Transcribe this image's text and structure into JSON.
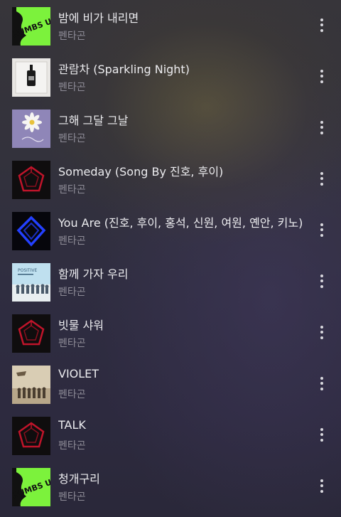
{
  "tracks": [
    {
      "title": "밤에 비가 내리면",
      "artist": "펜타곤",
      "cover": "thumbs-up-art"
    },
    {
      "title": "관람차 (Sparkling Night)",
      "artist": "펜타곤",
      "cover": "bottle-art"
    },
    {
      "title": "그해 그달 그날",
      "artist": "펜타곤",
      "cover": "daisy-art"
    },
    {
      "title": "Someday (Song By 진호, 후이)",
      "artist": "펜타곤",
      "cover": "red-pentagon-art"
    },
    {
      "title": "You Are (진호, 후이, 홍석, 신원, 여원, 옌안, 키노)",
      "artist": "펜타곤",
      "cover": "blue-pentagon-art"
    },
    {
      "title": "함께 가자 우리",
      "artist": "펜타곤",
      "cover": "positive-group-art"
    },
    {
      "title": "빗물 샤워",
      "artist": "펜타곤",
      "cover": "red-pentagon-art"
    },
    {
      "title": "VIOLET",
      "artist": "펜타곤",
      "cover": "sepia-group-art"
    },
    {
      "title": "TALK",
      "artist": "펜타곤",
      "cover": "red-pentagon-art"
    },
    {
      "title": "청개구리",
      "artist": "펜타곤",
      "cover": "thumbs-up-art"
    }
  ],
  "covers": {
    "thumbs_up": {
      "logo_text": "THUMBS UP!"
    },
    "positive": {
      "logo_text": "POSITIVE"
    }
  },
  "colors": {
    "title": "#ececef",
    "artist": "#8e8c97",
    "neon_green": "#7cf23c",
    "pentagon_red": "#c0142a",
    "pentagon_blue": "#2340ff"
  }
}
